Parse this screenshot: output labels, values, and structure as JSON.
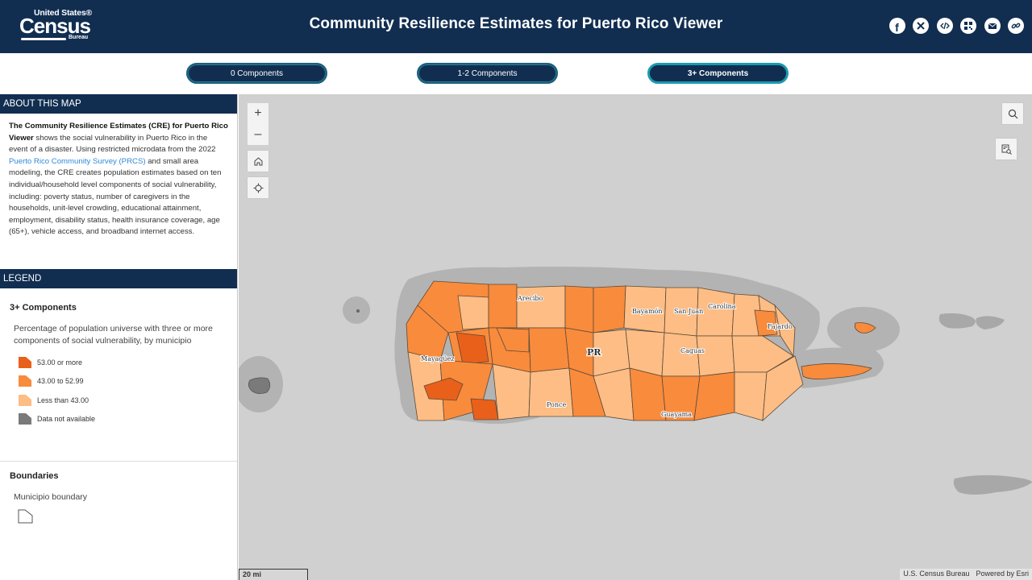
{
  "header": {
    "logo": {
      "line1": "United States®",
      "line2": "Census",
      "line3": "Bureau"
    },
    "title": "Community Resilience Estimates for Puerto Rico Viewer",
    "share_icons": [
      {
        "name": "facebook-icon",
        "glyph": "f"
      },
      {
        "name": "x-twitter-icon",
        "glyph": "𝕏"
      },
      {
        "name": "embed-code-icon",
        "glyph": "</>"
      },
      {
        "name": "qr-code-icon",
        "glyph": "▦"
      },
      {
        "name": "email-icon",
        "glyph": "✉"
      },
      {
        "name": "link-icon",
        "glyph": "🔗"
      }
    ]
  },
  "tabs": [
    {
      "label": "0 Components",
      "active": false
    },
    {
      "label": "1-2 Components",
      "active": false
    },
    {
      "label": "3+ Components",
      "active": true
    }
  ],
  "about": {
    "heading": "ABOUT THIS MAP",
    "bold_lead": "The Community Resilience Estimates (CRE) for Puerto Rico Viewer",
    "text_1": " shows the social vulnerability in Puerto Rico in the event of a disaster. Using restricted microdata from the 2022 ",
    "link_text": "Puerto Rico Community Survey (PRCS)",
    "text_2": " and small area modeling, the CRE creates population estimates based on ten individual/household level components of social vulnerability, including: poverty status, number of caregivers in the households, unit-level crowding, educational attainment, employment, disability status, health insurance coverage, age (65+), vehicle access, and broadband internet access."
  },
  "legend": {
    "heading": "LEGEND",
    "layer_title": "3+ Components",
    "description": "Percentage of population universe with three or more components of social vulnerability, by municipio",
    "classes": [
      {
        "label": "53.00 or more",
        "color": "#e8601a"
      },
      {
        "label": "43.00 to 52.99",
        "color": "#f98b3c"
      },
      {
        "label": "Less than 43.00",
        "color": "#fdbd84"
      },
      {
        "label": "Data not available",
        "color": "#7a7a7a"
      }
    ],
    "boundaries_title": "Boundaries",
    "boundary_label": "Municipio boundary"
  },
  "map": {
    "places": [
      "Arecibo",
      "Bayamón",
      "San Juan",
      "Carolina",
      "Fajardo",
      "Mayagüez",
      "Caguas",
      "Ponce",
      "Guayama"
    ],
    "region_label": "PR",
    "controls": {
      "zoom_in": "+",
      "zoom_out": "–"
    },
    "scalebar": "20 mi",
    "attribution": [
      "U.S. Census Bureau",
      "Powered by Esri"
    ]
  }
}
